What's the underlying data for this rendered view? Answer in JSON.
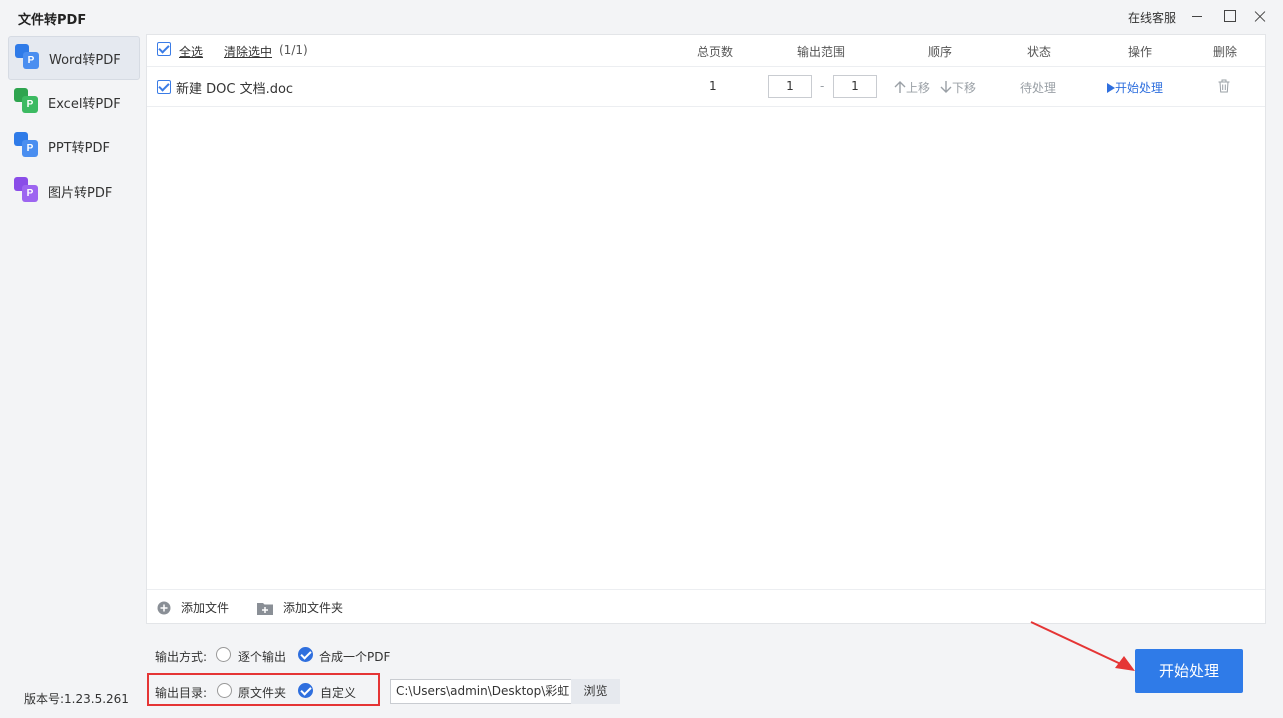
{
  "window": {
    "title": "文件转PDF",
    "support": "在线客服"
  },
  "sidebar": {
    "items": [
      {
        "label": "Word转PDF",
        "color": "#2f7be8",
        "active": true
      },
      {
        "label": "Excel转PDF",
        "color": "#2ea44f",
        "active": false
      },
      {
        "label": "PPT转PDF",
        "color": "#2f7be8",
        "active": false
      },
      {
        "label": "图片转PDF",
        "color": "#8a4de8",
        "active": false
      }
    ],
    "icon_letter": "P",
    "version": "版本号:1.23.5.261"
  },
  "table": {
    "select_all": "全选",
    "clear_selection": "清除选中",
    "count": "(1/1)",
    "columns": {
      "pages": "总页数",
      "range": "输出范围",
      "order": "顺序",
      "status": "状态",
      "action": "操作",
      "delete": "删除"
    },
    "rows": [
      {
        "filename": "新建 DOC 文档.doc",
        "pages": "1",
        "range_from": "1",
        "range_sep": "-",
        "range_to": "1",
        "move_up": "上移",
        "move_down": "下移",
        "status": "待处理",
        "action": "开始处理"
      }
    ]
  },
  "bottom": {
    "add_file": "添加文件",
    "add_folder": "添加文件夹"
  },
  "options": {
    "output_mode_label": "输出方式:",
    "mode_each": "逐个输出",
    "mode_merge": "合成一个PDF",
    "output_dir_label": "输出目录:",
    "dir_original": "原文件夹",
    "dir_custom": "自定义",
    "path": "C:\\Users\\admin\\Desktop\\彩虹",
    "browse": "浏览"
  },
  "start_button": "开始处理",
  "colors": {
    "accent": "#2f7be8",
    "highlight": "#e53535"
  }
}
